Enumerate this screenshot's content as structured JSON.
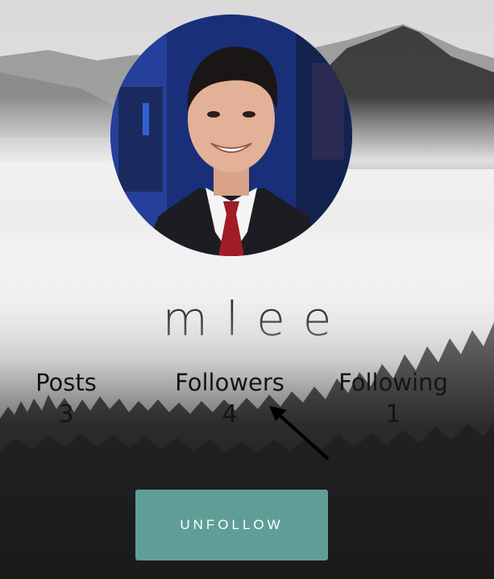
{
  "profile": {
    "username": "mlee",
    "stats": {
      "posts_label": "Posts",
      "posts_count": "3",
      "followers_label": "Followers",
      "followers_count": "4",
      "following_label": "Following",
      "following_count": "1"
    },
    "unfollow_label": "UNFOLLOW"
  },
  "colors": {
    "button": "#5f9e97",
    "text": "#141414"
  }
}
